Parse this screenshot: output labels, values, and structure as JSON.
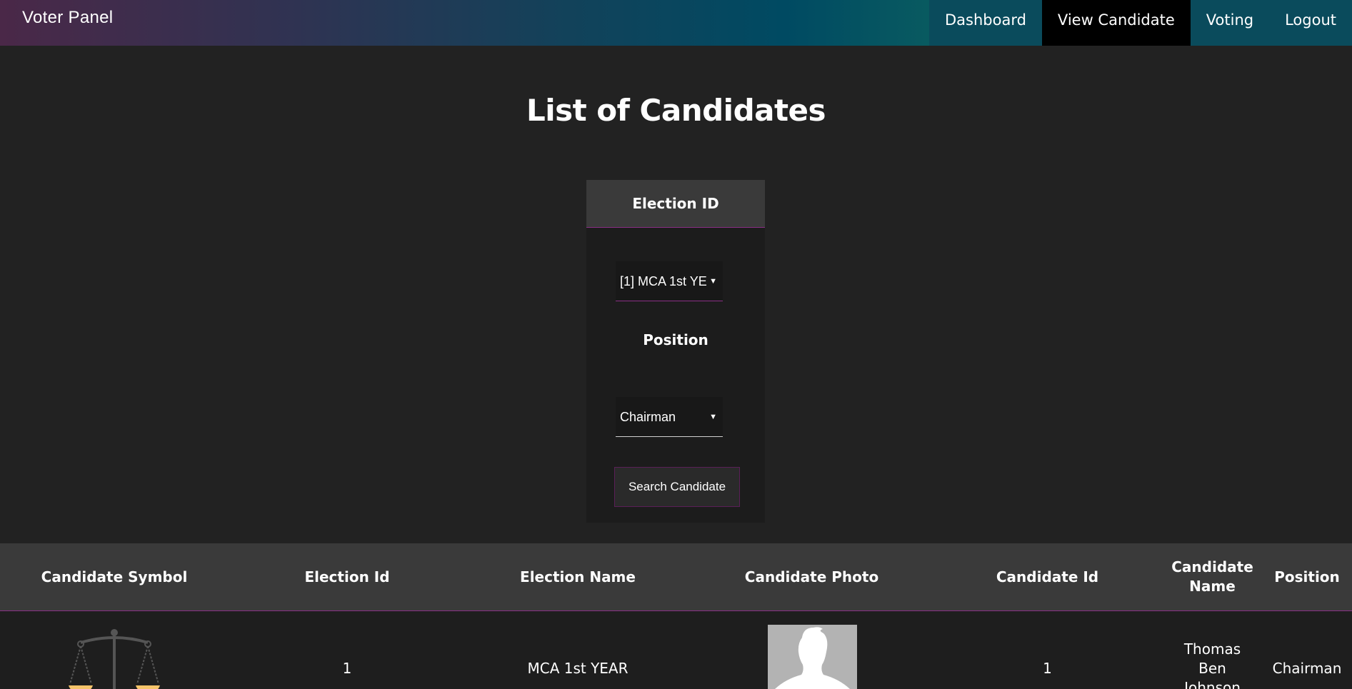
{
  "brand": "Voter Panel",
  "nav": {
    "dashboard": "Dashboard",
    "view_candidate": "View Candidate",
    "voting": "Voting",
    "logout": "Logout"
  },
  "page_title": "List of Candidates",
  "search_panel": {
    "election_label": "Election ID",
    "election_selected": "[1] MCA 1st YE",
    "position_label": "Position",
    "position_selected": "Chairman",
    "search_button": "Search Candidate"
  },
  "table": {
    "headers": {
      "symbol": "Candidate Symbol",
      "election_id": "Election Id",
      "election_name": "Election Name",
      "photo": "Candidate Photo",
      "candidate_id": "Candidate Id",
      "candidate_name_1": "Candidate",
      "candidate_name_2": "Name",
      "position": "Position"
    },
    "rows": [
      {
        "symbol_icon": "scales-icon",
        "election_id": "1",
        "election_name": "MCA 1st YEAR",
        "photo_icon": "avatar-placeholder-icon",
        "candidate_id": "1",
        "name_line_1": "Thomas",
        "name_line_2": "Ben",
        "name_line_3": "Johnson",
        "position": "Chairman"
      }
    ]
  },
  "colors": {
    "accent": "#8a2f86",
    "active_nav": "#000000",
    "background": "#222222",
    "panel_head": "#3a3a3a"
  }
}
